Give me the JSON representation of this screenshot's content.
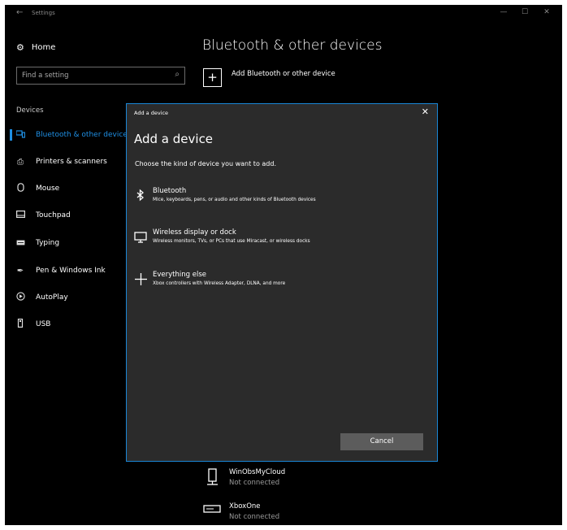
{
  "window": {
    "title": "Settings",
    "back_glyph": "←",
    "controls": {
      "minimize": "—",
      "maximize": "☐",
      "close": "✕"
    }
  },
  "sidebar": {
    "home_label": "Home",
    "home_icon": "gear-icon",
    "search_placeholder": "Find a setting",
    "section_label": "Devices",
    "items": [
      {
        "label": "Bluetooth & other devices",
        "icon": "bluetooth-devices-icon",
        "active": true
      },
      {
        "label": "Printers & scanners",
        "icon": "printer-icon",
        "active": false
      },
      {
        "label": "Mouse",
        "icon": "mouse-icon",
        "active": false
      },
      {
        "label": "Touchpad",
        "icon": "touchpad-icon",
        "active": false
      },
      {
        "label": "Typing",
        "icon": "keyboard-icon",
        "active": false
      },
      {
        "label": "Pen & Windows Ink",
        "icon": "pen-icon",
        "active": false
      },
      {
        "label": "AutoPlay",
        "icon": "autoplay-icon",
        "active": false
      },
      {
        "label": "USB",
        "icon": "usb-icon",
        "active": false
      }
    ],
    "accent_color": "#1f8fe3"
  },
  "main": {
    "title": "Bluetooth & other devices",
    "add_button_label": "Add Bluetooth or other device",
    "devices": [
      {
        "name": "WinObsMyCloud",
        "status": "Not connected",
        "icon": "phone-icon"
      },
      {
        "name": "XboxOne",
        "status": "Not connected",
        "icon": "console-icon"
      }
    ]
  },
  "dialog": {
    "title": "Add a device",
    "heading": "Add a device",
    "subtitle": "Choose the kind of device you want to add.",
    "options": [
      {
        "name": "Bluetooth",
        "description": "Mice, keyboards, pens, or audio and other kinds of Bluetooth devices",
        "icon": "bluetooth-icon"
      },
      {
        "name": "Wireless display or dock",
        "description": "Wireless monitors, TVs, or PCs that use Miracast, or wireless docks",
        "icon": "monitor-icon"
      },
      {
        "name": "Everything else",
        "description": "Xbox controllers with Wireless Adapter, DLNA, and more",
        "icon": "plus-icon"
      }
    ],
    "cancel_label": "Cancel",
    "border_color": "#1a86d6"
  }
}
